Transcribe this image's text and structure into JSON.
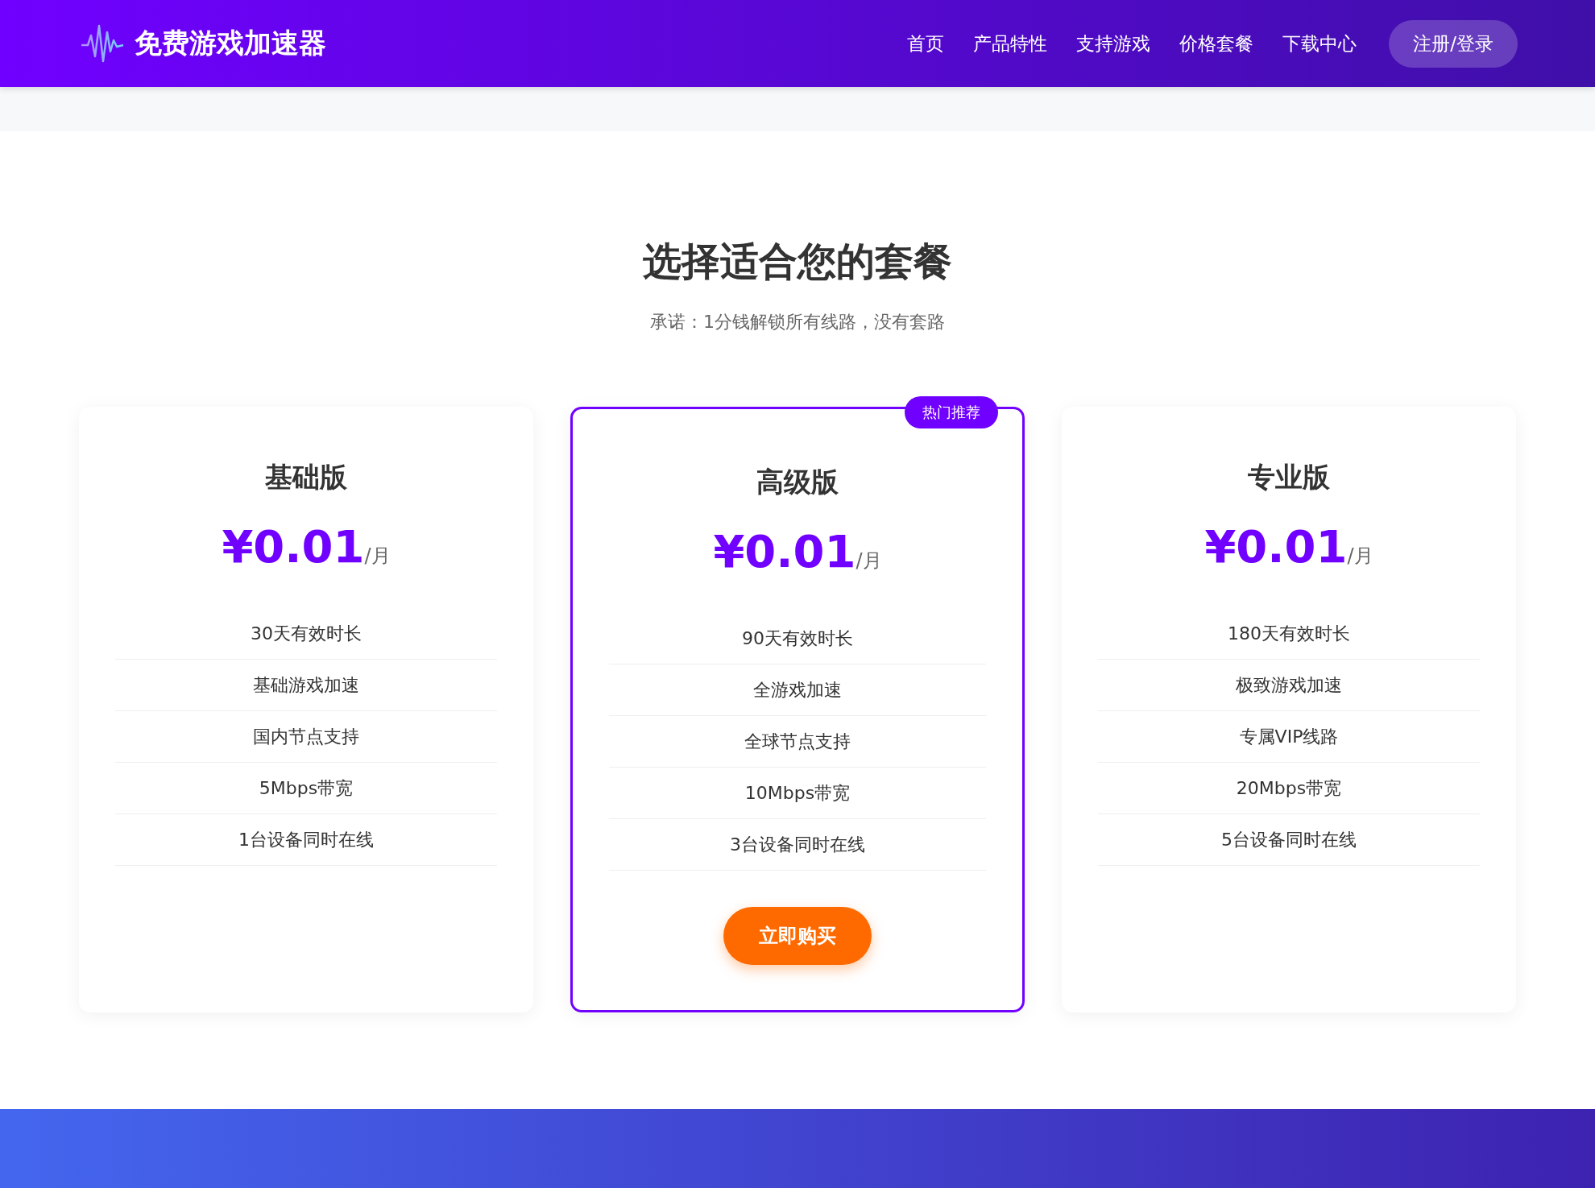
{
  "header": {
    "logo": "免费游戏加速器",
    "nav": [
      {
        "label": "首页"
      },
      {
        "label": "产品特性"
      },
      {
        "label": "支持游戏"
      },
      {
        "label": "价格套餐"
      },
      {
        "label": "下载中心"
      }
    ],
    "login_button": "注册/登录"
  },
  "pricing": {
    "title": "选择适合您的套餐",
    "subtitle": "承诺：1分钱解锁所有线路，没有套路",
    "plans": [
      {
        "name": "基础版",
        "price": "¥0.01",
        "period": "/月",
        "featured": false,
        "features": [
          "30天有效时长",
          "基础游戏加速",
          "国内节点支持",
          "5Mbps带宽",
          "1台设备同时在线"
        ]
      },
      {
        "name": "高级版",
        "price": "¥0.01",
        "period": "/月",
        "featured": true,
        "badge": "热门推荐",
        "button": "立即购买",
        "features": [
          "90天有效时长",
          "全游戏加速",
          "全球节点支持",
          "10Mbps带宽",
          "3台设备同时在线"
        ]
      },
      {
        "name": "专业版",
        "price": "¥0.01",
        "period": "/月",
        "featured": false,
        "features": [
          "180天有效时长",
          "极致游戏加速",
          "专属VIP线路",
          "20Mbps带宽",
          "5台设备同时在线"
        ]
      }
    ]
  }
}
